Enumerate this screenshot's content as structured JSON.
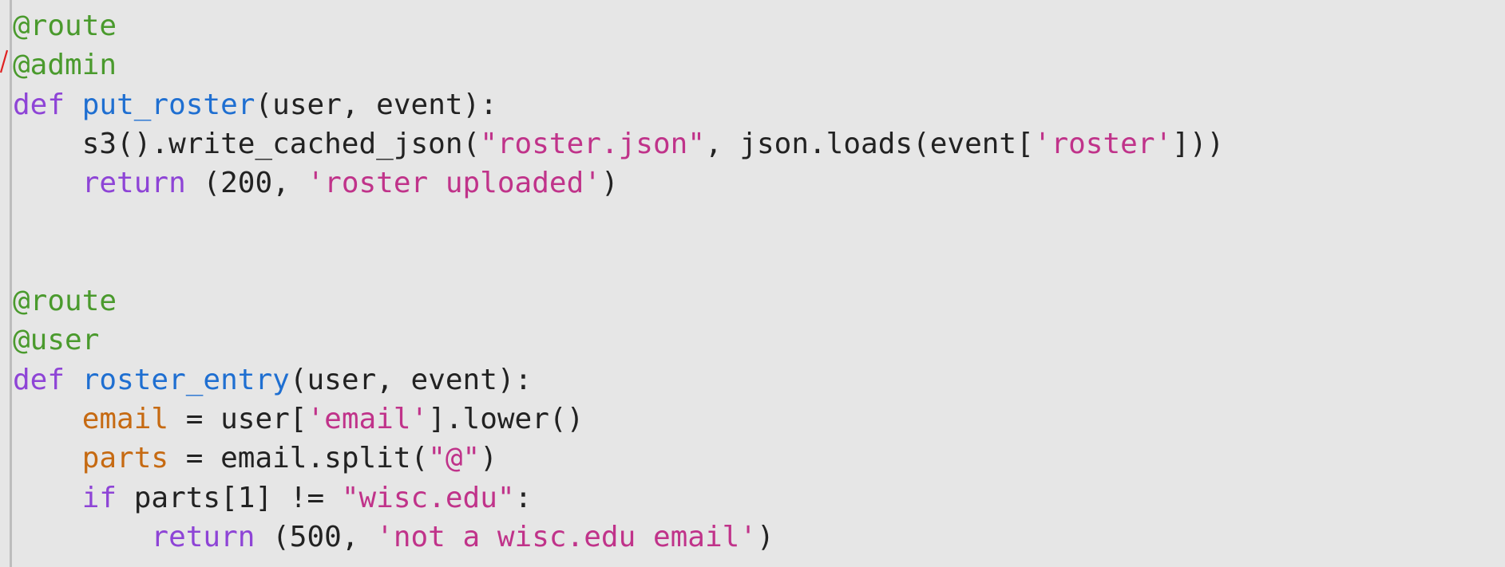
{
  "colors": {
    "background": "#e6e6e6",
    "decorator": "#4a9a2d",
    "keyword": "#8e44d6",
    "function_name": "#1f6fd1",
    "string": "#c0338a",
    "variable": "#c66a12",
    "default": "#222222",
    "annotation_mark": "#e02020"
  },
  "code": {
    "lines": [
      [
        {
          "t": "@route",
          "c": "decorator"
        }
      ],
      [
        {
          "t": "@admin",
          "c": "decorator"
        }
      ],
      [
        {
          "t": "def",
          "c": "keyword"
        },
        {
          "t": " ",
          "c": "default"
        },
        {
          "t": "put_roster",
          "c": "function_name"
        },
        {
          "t": "(user, event):",
          "c": "default"
        }
      ],
      [
        {
          "t": "    s3().write_cached_json(",
          "c": "default"
        },
        {
          "t": "\"roster.json\"",
          "c": "string"
        },
        {
          "t": ", json.loads(event[",
          "c": "default"
        },
        {
          "t": "'roster'",
          "c": "string"
        },
        {
          "t": "]))",
          "c": "default"
        }
      ],
      [
        {
          "t": "    ",
          "c": "default"
        },
        {
          "t": "return",
          "c": "keyword"
        },
        {
          "t": " (200, ",
          "c": "default"
        },
        {
          "t": "'roster uploaded'",
          "c": "string"
        },
        {
          "t": ")",
          "c": "default"
        }
      ],
      [],
      [],
      [
        {
          "t": "@route",
          "c": "decorator"
        }
      ],
      [
        {
          "t": "@user",
          "c": "decorator"
        }
      ],
      [
        {
          "t": "def",
          "c": "keyword"
        },
        {
          "t": " ",
          "c": "default"
        },
        {
          "t": "roster_entry",
          "c": "function_name"
        },
        {
          "t": "(user, event):",
          "c": "default"
        }
      ],
      [
        {
          "t": "    ",
          "c": "default"
        },
        {
          "t": "email",
          "c": "variable"
        },
        {
          "t": " = user[",
          "c": "default"
        },
        {
          "t": "'email'",
          "c": "string"
        },
        {
          "t": "].lower()",
          "c": "default"
        }
      ],
      [
        {
          "t": "    ",
          "c": "default"
        },
        {
          "t": "parts",
          "c": "variable"
        },
        {
          "t": " = email.split(",
          "c": "default"
        },
        {
          "t": "\"@\"",
          "c": "string"
        },
        {
          "t": ")",
          "c": "default"
        }
      ],
      [
        {
          "t": "    ",
          "c": "default"
        },
        {
          "t": "if",
          "c": "keyword"
        },
        {
          "t": " parts[1] != ",
          "c": "default"
        },
        {
          "t": "\"wisc.edu\"",
          "c": "string"
        },
        {
          "t": ":",
          "c": "default"
        }
      ],
      [
        {
          "t": "        ",
          "c": "default"
        },
        {
          "t": "return",
          "c": "keyword"
        },
        {
          "t": " (500, ",
          "c": "default"
        },
        {
          "t": "'not a wisc.edu email'",
          "c": "string"
        },
        {
          "t": ")",
          "c": "default"
        }
      ]
    ]
  }
}
